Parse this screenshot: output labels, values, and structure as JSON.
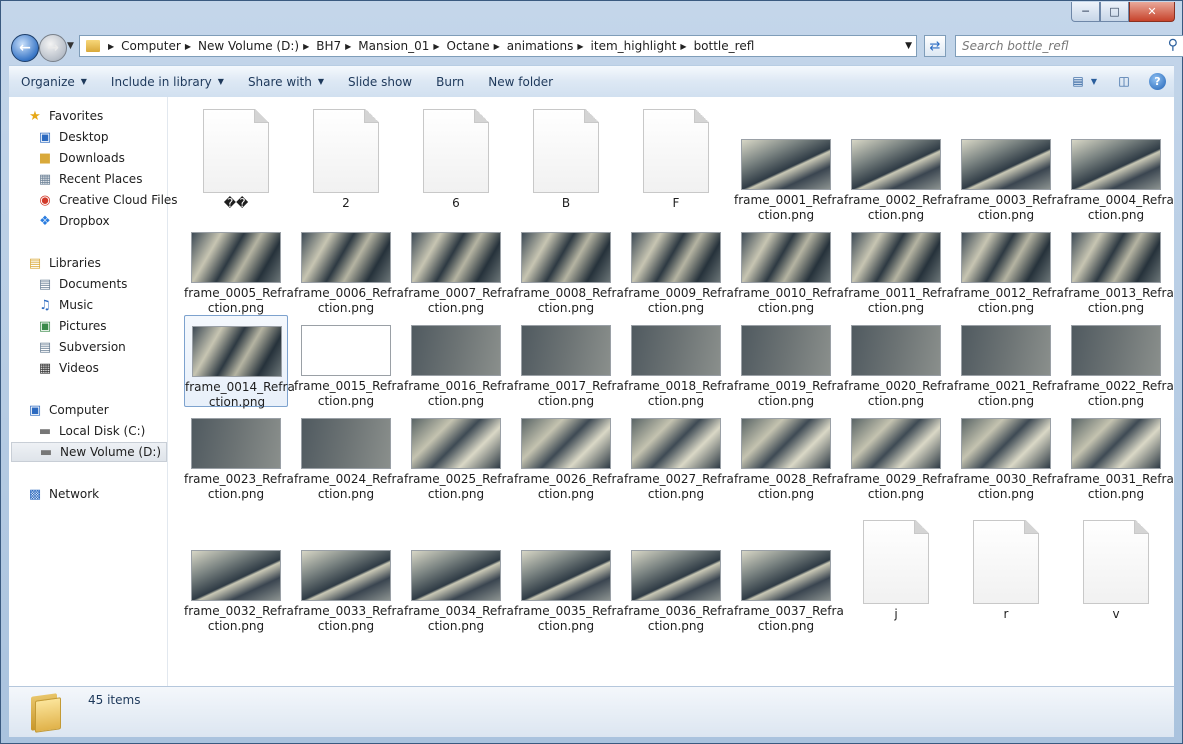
{
  "window": {
    "caption_buttons": [
      "minimize",
      "maximize",
      "close"
    ]
  },
  "address": {
    "crumbs": [
      "Computer",
      "New Volume (D:)",
      "BH7",
      "Mansion_01",
      "Octane",
      "animations",
      "item_highlight",
      "bottle_refl"
    ]
  },
  "search": {
    "placeholder": "Search bottle_refl"
  },
  "toolbar": {
    "organize": "Organize",
    "include": "Include in library",
    "share": "Share with",
    "slideshow": "Slide show",
    "burn": "Burn",
    "newfolder": "New folder"
  },
  "nav": {
    "favorites": "Favorites",
    "desktop": "Desktop",
    "downloads": "Downloads",
    "recent": "Recent Places",
    "creative": "Creative Cloud Files",
    "dropbox": "Dropbox",
    "libraries": "Libraries",
    "documents": "Documents",
    "music": "Music",
    "pictures": "Pictures",
    "subversion": "Subversion",
    "videos": "Videos",
    "computer": "Computer",
    "localdisk": "Local Disk (C:)",
    "newvolume": "New Volume (D:)",
    "network": "Network"
  },
  "files": [
    {
      "l1": "��",
      "l2": "",
      "kind": "doc"
    },
    {
      "l1": "2",
      "l2": "",
      "kind": "doc"
    },
    {
      "l1": "6",
      "l2": "",
      "kind": "doc"
    },
    {
      "l1": "B",
      "l2": "",
      "kind": "doc"
    },
    {
      "l1": "F",
      "l2": "",
      "kind": "doc"
    },
    {
      "l1": "frame_0001_Refra",
      "l2": "ction.png",
      "kind": "img"
    },
    {
      "l1": "frame_0002_Refra",
      "l2": "ction.png",
      "kind": "img"
    },
    {
      "l1": "frame_0003_Refra",
      "l2": "ction.png",
      "kind": "img"
    },
    {
      "l1": "frame_0004_Refra",
      "l2": "ction.png",
      "kind": "img"
    },
    {
      "l1": "frame_0005_Refra",
      "l2": "ction.png",
      "kind": "img"
    },
    {
      "l1": "frame_0006_Refra",
      "l2": "ction.png",
      "kind": "img"
    },
    {
      "l1": "frame_0007_Refra",
      "l2": "ction.png",
      "kind": "img"
    },
    {
      "l1": "frame_0008_Refra",
      "l2": "ction.png",
      "kind": "img"
    },
    {
      "l1": "frame_0009_Refra",
      "l2": "ction.png",
      "kind": "img"
    },
    {
      "l1": "frame_0010_Refra",
      "l2": "ction.png",
      "kind": "img"
    },
    {
      "l1": "frame_0011_Refra",
      "l2": "ction.png",
      "kind": "img"
    },
    {
      "l1": "frame_0012_Refra",
      "l2": "ction.png",
      "kind": "img"
    },
    {
      "l1": "frame_0013_Refra",
      "l2": "ction.png",
      "kind": "img"
    },
    {
      "l1": "frame_0014_Refra",
      "l2": "ction.png",
      "kind": "img"
    },
    {
      "l1": "frame_0015_Refra",
      "l2": "ction.png",
      "kind": "img"
    },
    {
      "l1": "frame_0016_Refra",
      "l2": "ction.png",
      "kind": "img"
    },
    {
      "l1": "frame_0017_Refra",
      "l2": "ction.png",
      "kind": "img"
    },
    {
      "l1": "frame_0018_Refra",
      "l2": "ction.png",
      "kind": "img"
    },
    {
      "l1": "frame_0019_Refra",
      "l2": "ction.png",
      "kind": "img"
    },
    {
      "l1": "frame_0020_Refra",
      "l2": "ction.png",
      "kind": "img"
    },
    {
      "l1": "frame_0021_Refra",
      "l2": "ction.png",
      "kind": "img"
    },
    {
      "l1": "frame_0022_Refra",
      "l2": "ction.png",
      "kind": "img"
    },
    {
      "l1": "frame_0023_Refra",
      "l2": "ction.png",
      "kind": "img"
    },
    {
      "l1": "frame_0024_Refra",
      "l2": "ction.png",
      "kind": "img"
    },
    {
      "l1": "frame_0025_Refra",
      "l2": "ction.png",
      "kind": "img"
    },
    {
      "l1": "frame_0026_Refra",
      "l2": "ction.png",
      "kind": "img"
    },
    {
      "l1": "frame_0027_Refra",
      "l2": "ction.png",
      "kind": "img"
    },
    {
      "l1": "frame_0028_Refra",
      "l2": "ction.png",
      "kind": "img"
    },
    {
      "l1": "frame_0029_Refra",
      "l2": "ction.png",
      "kind": "img"
    },
    {
      "l1": "frame_0030_Refra",
      "l2": "ction.png",
      "kind": "img"
    },
    {
      "l1": "frame_0031_Refra",
      "l2": "ction.png",
      "kind": "img"
    },
    {
      "l1": "frame_0032_Refra",
      "l2": "ction.png",
      "kind": "img"
    },
    {
      "l1": "frame_0033_Refra",
      "l2": "ction.png",
      "kind": "img"
    },
    {
      "l1": "frame_0034_Refra",
      "l2": "ction.png",
      "kind": "img"
    },
    {
      "l1": "frame_0035_Refra",
      "l2": "ction.png",
      "kind": "img"
    },
    {
      "l1": "frame_0036_Refra",
      "l2": "ction.png",
      "kind": "img"
    },
    {
      "l1": "frame_0037_Refra",
      "l2": "ction.png",
      "kind": "img"
    },
    {
      "l1": "j",
      "l2": "",
      "kind": "doc"
    },
    {
      "l1": "r",
      "l2": "",
      "kind": "doc"
    },
    {
      "l1": "v",
      "l2": "",
      "kind": "doc"
    }
  ],
  "status": {
    "count": "45 items"
  }
}
